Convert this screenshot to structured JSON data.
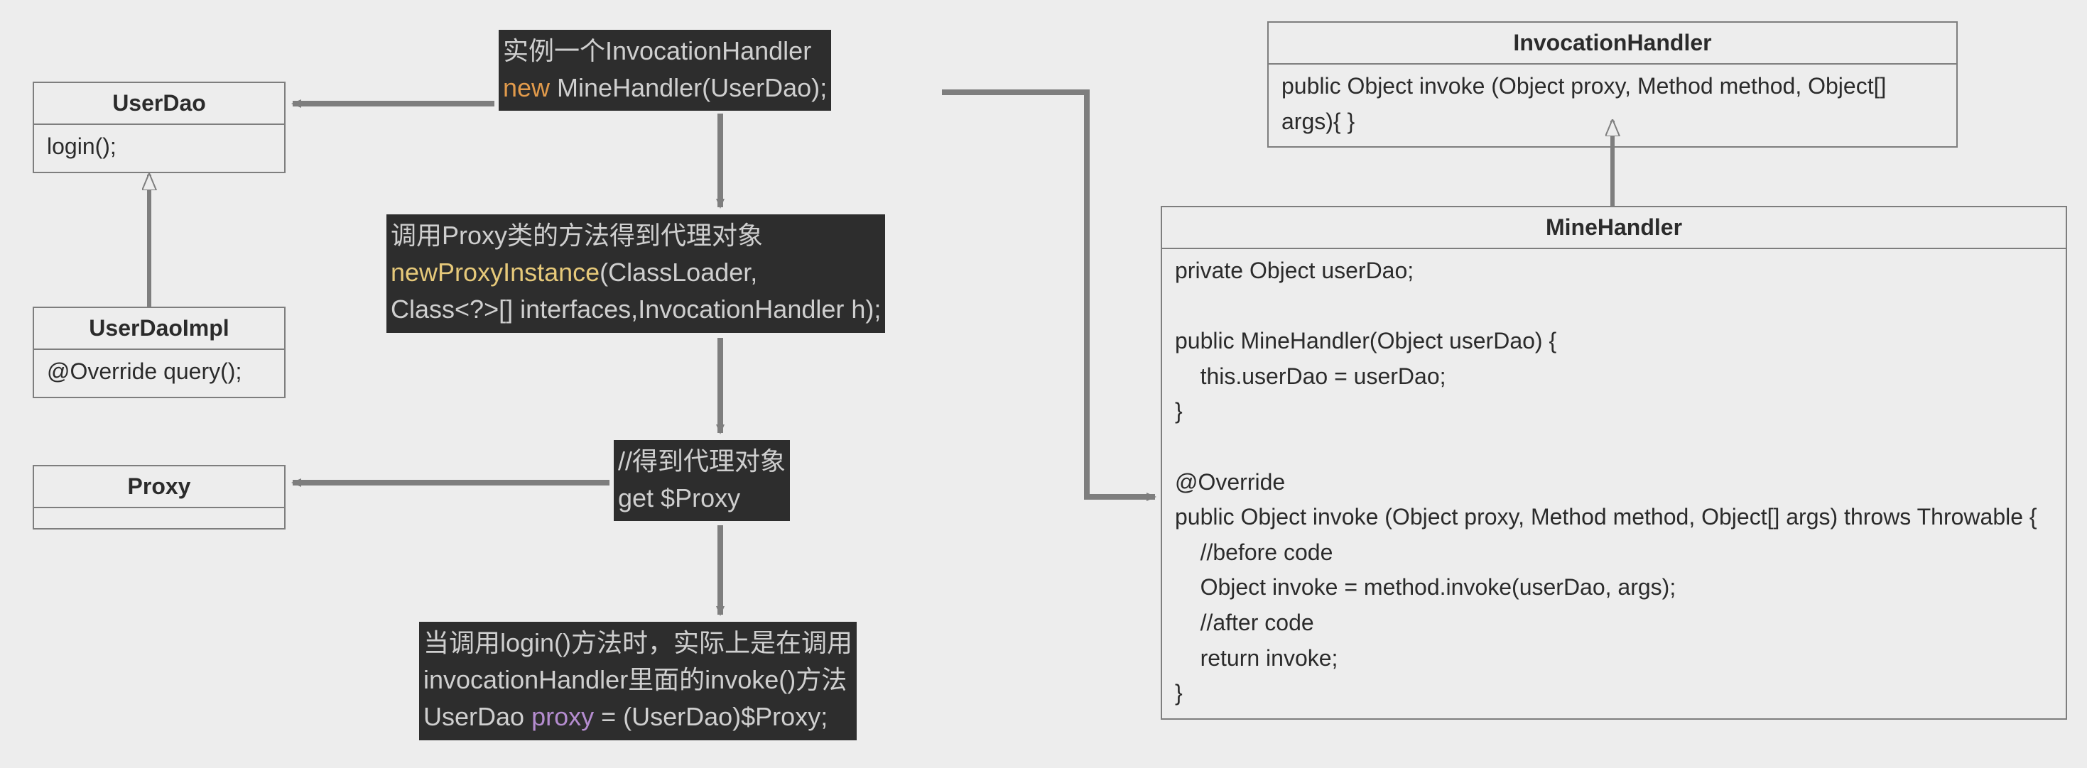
{
  "uml": {
    "userDao": {
      "title": "UserDao",
      "body": "login();"
    },
    "userDaoImpl": {
      "title": "UserDaoImpl",
      "body": "@Override query();"
    },
    "proxy": {
      "title": "Proxy",
      "body": ""
    },
    "invocationHandler": {
      "title": "InvocationHandler",
      "body": "public Object invoke (Object proxy, Method method, Object[] args){ }"
    },
    "mineHandler": {
      "title": "MineHandler",
      "body": "private Object userDao;\n\npublic MineHandler(Object userDao) {\n    this.userDao = userDao;\n}\n\n@Override\npublic Object invoke (Object proxy, Method method, Object[] args) throws Throwable {\n    //before code\n    Object invoke = method.invoke(userDao, args);\n    //after code\n    return invoke;\n}"
    }
  },
  "code": {
    "box1": {
      "line1": "实例一个InvocationHandler",
      "kw_new": "new",
      "line2_rest": " MineHandler(UserDao)",
      "semi": ";"
    },
    "box2": {
      "line1": "调用Proxy类的方法得到代理对象",
      "kw_method": "newProxyInstance",
      "args1": "(ClassLoader",
      "comma1": ",",
      "args2": "Class<?>[] interfaces",
      "comma2": ",",
      "args3": "InvocationHandler h)",
      "semi": ";"
    },
    "box3": {
      "line1": "//得到代理对象",
      "line2": "get $Proxy"
    },
    "box4": {
      "line1": "当调用login()方法时，实际上是在调用",
      "line2": "invocationHandler里面的invoke()方法",
      "line3a": "UserDao ",
      "line3_kw": "proxy",
      "line3b": " = (UserDao)$Proxy",
      "semi": ";"
    }
  }
}
